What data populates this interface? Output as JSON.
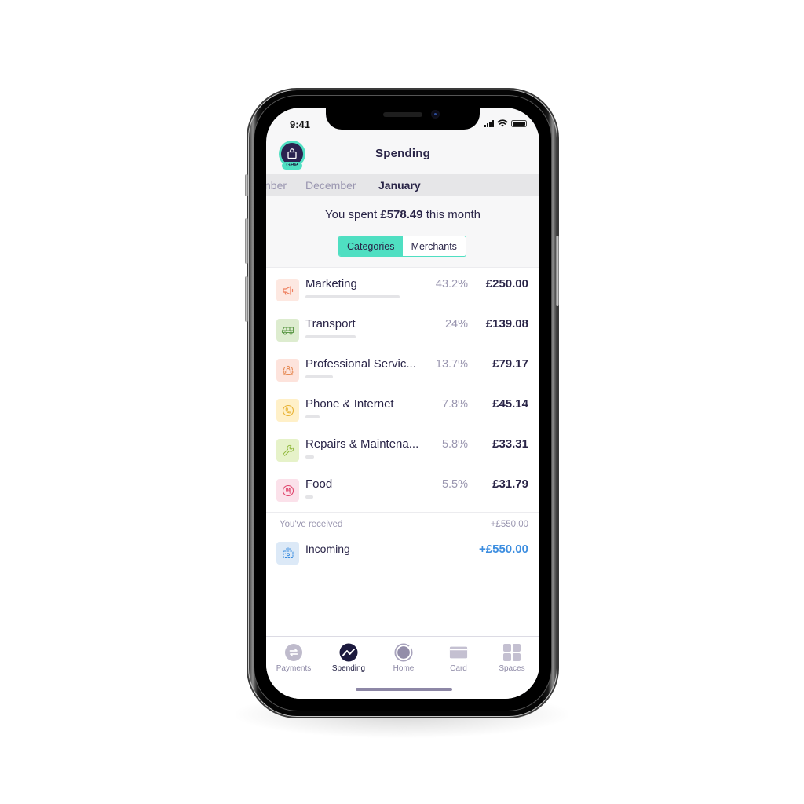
{
  "status_bar": {
    "time": "9:41"
  },
  "header": {
    "title": "Spending",
    "account_badge": "GBP"
  },
  "months": {
    "items": [
      "November",
      "December",
      "January"
    ],
    "visible_partial": "nber",
    "selected": "January"
  },
  "summary": {
    "prefix": "You spent ",
    "amount": "£578.49",
    "suffix": " this month"
  },
  "segmented_control": {
    "options": [
      "Categories",
      "Merchants"
    ],
    "selected": "Categories"
  },
  "categories": [
    {
      "name": "Marketing",
      "percent": "43.2%",
      "amount": "£250.00",
      "share": 43.2,
      "icon": "megaphone-icon",
      "icon_color": "#ee7f5e",
      "icon_bg": "#fde8e1"
    },
    {
      "name": "Transport",
      "percent": "24%",
      "amount": "£139.08",
      "share": 24,
      "icon": "van-icon",
      "icon_color": "#5f9a4a",
      "icon_bg": "#ddeccf"
    },
    {
      "name": "Professional Servic...",
      "percent": "13.7%",
      "amount": "£79.17",
      "share": 13.7,
      "icon": "people-network-icon",
      "icon_color": "#e68a55",
      "icon_bg": "#fde3dc"
    },
    {
      "name": "Phone & Internet",
      "percent": "7.8%",
      "amount": "£45.14",
      "share": 7.8,
      "icon": "phone-icon",
      "icon_color": "#e8b233",
      "icon_bg": "#fff0c8"
    },
    {
      "name": "Repairs & Maintena...",
      "percent": "5.8%",
      "amount": "£33.31",
      "share": 5.8,
      "icon": "wrench-icon",
      "icon_color": "#90b83a",
      "icon_bg": "#e6f2c9"
    },
    {
      "name": "Food",
      "percent": "5.5%",
      "amount": "£31.79",
      "share": 5.5,
      "icon": "cutlery-icon",
      "icon_color": "#e0456d",
      "icon_bg": "#fbe1ea"
    }
  ],
  "received": {
    "label": "You've received",
    "total": "+£550.00",
    "items": [
      {
        "name": "Incoming",
        "amount": "+£550.00",
        "icon": "cash-register-icon",
        "icon_color": "#3d8ee0"
      }
    ]
  },
  "tabbar": {
    "items": [
      {
        "label": "Payments",
        "icon": "transfer-arrows-icon"
      },
      {
        "label": "Spending",
        "icon": "trend-line-icon"
      },
      {
        "label": "Home",
        "icon": "home-ring-icon"
      },
      {
        "label": "Card",
        "icon": "card-icon"
      },
      {
        "label": "Spaces",
        "icon": "grid-icon"
      }
    ],
    "selected": "Spending"
  },
  "colors": {
    "accent": "#4fdfc2",
    "text_primary": "#2a2548",
    "text_muted": "#9a96b0",
    "incoming": "#3d8ee0"
  }
}
